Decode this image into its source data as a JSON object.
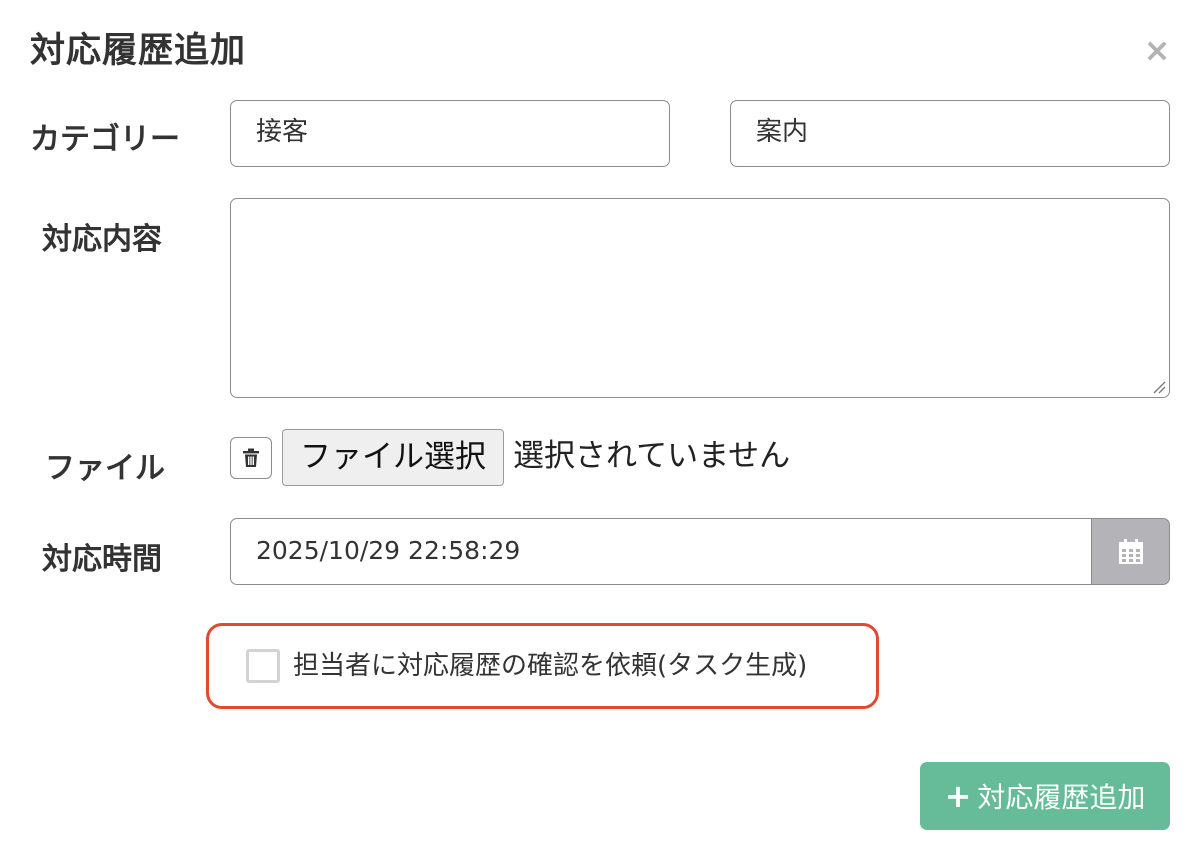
{
  "modal": {
    "title": "対応履歴追加",
    "close_glyph": "×"
  },
  "category": {
    "label": "カテゴリー",
    "primary_value": "接客",
    "secondary_value": "案内"
  },
  "content": {
    "label": "対応内容",
    "value": ""
  },
  "file": {
    "label": "ファイル",
    "choose_button": "ファイル選択",
    "status": "選択されていません",
    "delete_icon": "trash-icon"
  },
  "time": {
    "label": "対応時間",
    "value": "2025/10/29 22:58:29",
    "picker_icon": "calendar-icon"
  },
  "task_request": {
    "label": "担当者に対応履歴の確認を依頼(タスク生成)",
    "checked": false,
    "highlight_color": "#e14a31"
  },
  "submit": {
    "icon": "+",
    "label": "対応履歴追加",
    "color": "#66bb99"
  }
}
